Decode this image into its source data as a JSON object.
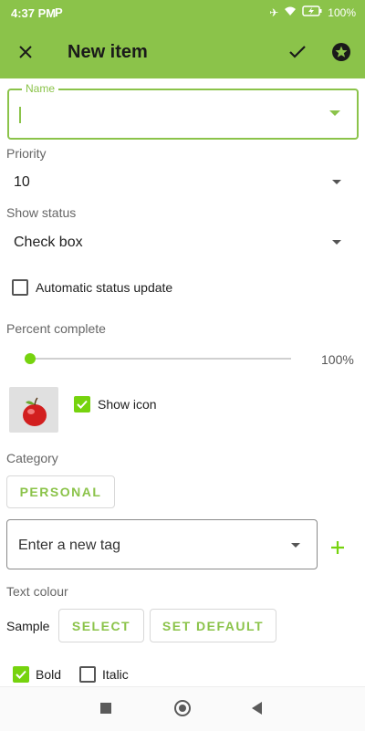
{
  "status_bar": {
    "time": "4:37 PM",
    "indicator": "P",
    "battery": "100%"
  },
  "app_bar": {
    "title": "New item"
  },
  "name_field": {
    "label": "Name",
    "value": ""
  },
  "priority": {
    "label": "Priority",
    "value": "10"
  },
  "show_status": {
    "label": "Show status",
    "value": "Check box"
  },
  "auto_status": {
    "label": "Automatic status update",
    "checked": false
  },
  "percent": {
    "label": "Percent complete",
    "value_text": "100%",
    "slider_fraction": 0.0
  },
  "icon": {
    "show_icon_label": "Show icon",
    "checked": true
  },
  "category": {
    "label": "Category",
    "button": "PERSONAL"
  },
  "tag": {
    "placeholder": "Enter a new tag"
  },
  "text_colour": {
    "label": "Text colour",
    "sample": "Sample",
    "select": "SELECT",
    "set_default": "SET DEFAULT"
  },
  "style": {
    "bold": "Bold",
    "italic": "Italic",
    "bold_checked": true,
    "italic_checked": false
  },
  "colors": {
    "accent": "#8BC34A",
    "check": "#76D30E"
  }
}
